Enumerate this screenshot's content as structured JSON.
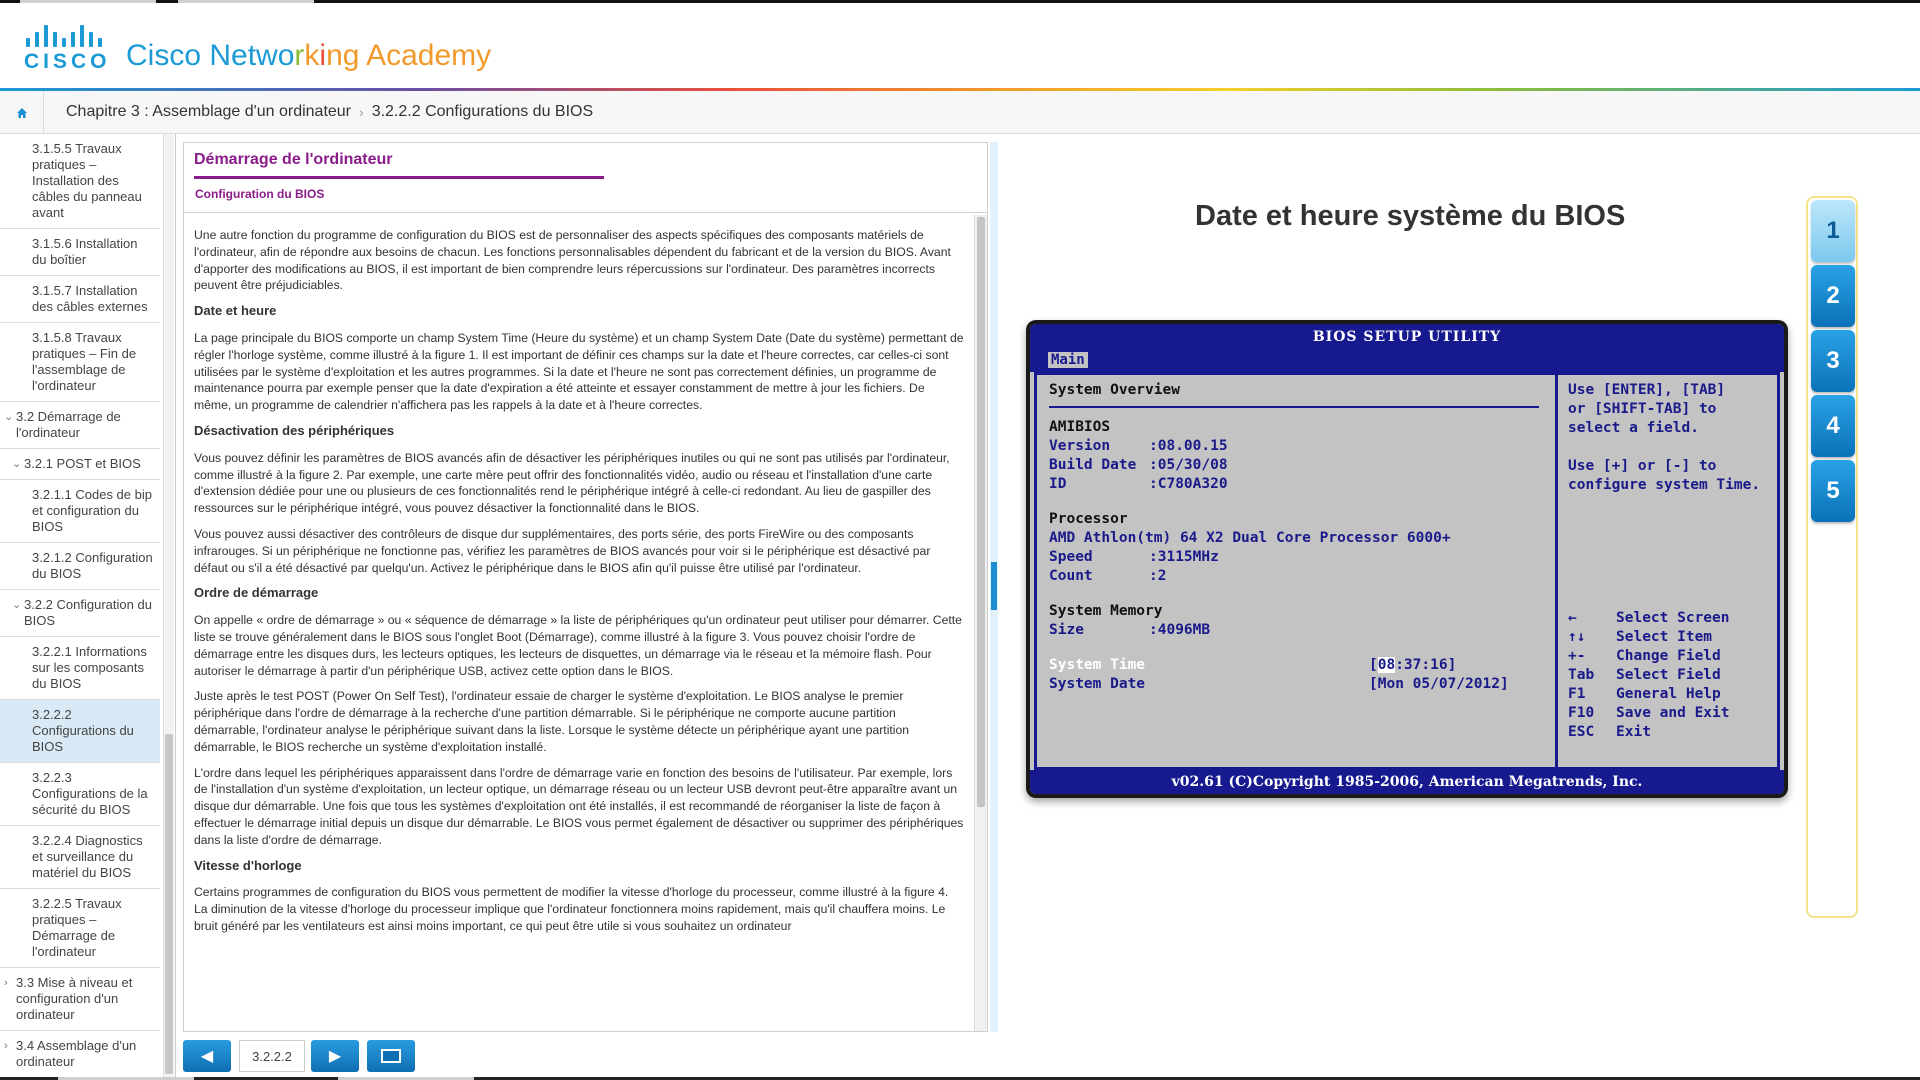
{
  "brand": {
    "logo_word": "CISCO",
    "name_parts": [
      "Cisco Netwo",
      "r",
      "k",
      "i",
      "ng Academy"
    ]
  },
  "breadcrumb": {
    "chapter": "Chapitre 3 : Assemblage d'un ordinateur",
    "section": "3.2.2.2 Configurations du BIOS"
  },
  "sidebar": {
    "items": [
      {
        "label": "3.1.5.5 Travaux pratiques – Installation des câbles du panneau avant",
        "level": 3
      },
      {
        "label": "3.1.5.6 Installation du boîtier",
        "level": 3
      },
      {
        "label": "3.1.5.7 Installation des câbles externes",
        "level": 3
      },
      {
        "label": "3.1.5.8 Travaux pratiques – Fin de l'assemblage de l'ordinateur",
        "level": 3
      },
      {
        "label": "3.2 Démarrage de l'ordinateur",
        "level": 1,
        "chevron": "⌄"
      },
      {
        "label": "3.2.1 POST et BIOS",
        "level": 2,
        "chevron": "⌄"
      },
      {
        "label": "3.2.1.1 Codes de bip et configuration du BIOS",
        "level": 3
      },
      {
        "label": "3.2.1.2 Configuration du BIOS",
        "level": 3
      },
      {
        "label": "3.2.2 Configuration du BIOS",
        "level": 2,
        "chevron": "⌄"
      },
      {
        "label": "3.2.2.1 Informations sur les composants du BIOS",
        "level": 3
      },
      {
        "label": "3.2.2.2 Configurations du BIOS",
        "level": 3,
        "active": true
      },
      {
        "label": "3.2.2.3 Configurations de la sécurité du BIOS",
        "level": 3
      },
      {
        "label": "3.2.2.4 Diagnostics et surveillance du matériel du BIOS",
        "level": 3
      },
      {
        "label": "3.2.2.5 Travaux pratiques – Démarrage de l'ordinateur",
        "level": 3
      },
      {
        "label": "3.3 Mise à niveau et configuration d'un ordinateur",
        "level": 1,
        "chevron": "›"
      },
      {
        "label": "3.4 Assemblage d'un ordinateur",
        "level": 1,
        "chevron": "›"
      }
    ]
  },
  "content": {
    "title": "Démarrage de l'ordinateur",
    "subtitle": "Configuration du BIOS",
    "blocks": [
      {
        "type": "p",
        "text": "Une autre fonction du programme de configuration du BIOS est de personnaliser des aspects spécifiques des composants matériels de l'ordinateur, afin de répondre aux besoins de chacun. Les fonctions personnalisables dépendent du fabricant et de la version du BIOS. Avant d'apporter des modifications au BIOS, il est important de bien comprendre leurs répercussions sur l'ordinateur. Des paramètres incorrects peuvent être préjudiciables."
      },
      {
        "type": "h",
        "text": "Date et heure"
      },
      {
        "type": "p",
        "text": "La page principale du BIOS comporte un champ System Time (Heure du système) et un champ System Date (Date du système) permettant de régler l'horloge système, comme illustré à la figure 1. Il est important de définir ces champs sur la date et l'heure correctes, car celles-ci sont utilisées par le système d'exploitation et les autres programmes. Si la date et l'heure ne sont pas correctement définies, un programme de maintenance pourra par exemple penser que la date d'expiration a été atteinte et essayer constamment de mettre à jour les fichiers. De même, un programme de calendrier n'affichera pas les rappels à la date et à l'heure correctes."
      },
      {
        "type": "h",
        "text": "Désactivation des périphériques"
      },
      {
        "type": "p",
        "text": "Vous pouvez définir les paramètres de BIOS avancés afin de désactiver les périphériques inutiles ou qui ne sont pas utilisés par l'ordinateur, comme illustré à la figure 2. Par exemple, une carte mère peut offrir des fonctionnalités vidéo, audio ou réseau et l'installation d'une carte d'extension dédiée pour une ou plusieurs de ces fonctionnalités rend le périphérique intégré à celle-ci redondant. Au lieu de gaspiller des ressources sur le périphérique intégré, vous pouvez désactiver la fonctionnalité dans le BIOS."
      },
      {
        "type": "p",
        "text": "Vous pouvez aussi désactiver des contrôleurs de disque dur supplémentaires, des ports série, des ports FireWire ou des composants infrarouges. Si un périphérique ne fonctionne pas, vérifiez les paramètres de BIOS avancés pour voir si le périphérique est désactivé par défaut ou s'il a été désactivé par quelqu'un. Activez le périphérique dans le BIOS afin qu'il puisse être utilisé par l'ordinateur."
      },
      {
        "type": "h",
        "text": "Ordre de démarrage"
      },
      {
        "type": "p",
        "text": "On appelle « ordre de démarrage » ou « séquence de démarrage » la liste de périphériques qu'un ordinateur peut utiliser pour démarrer. Cette liste se trouve généralement dans le BIOS sous l'onglet Boot (Démarrage), comme illustré à la figure 3. Vous pouvez choisir l'ordre de démarrage entre les disques durs, les lecteurs optiques, les lecteurs de disquettes, un démarrage via le réseau et la mémoire flash. Pour autoriser le démarrage à partir d'un périphérique USB, activez cette option dans le BIOS."
      },
      {
        "type": "p",
        "text": "Juste après le test POST (Power On Self Test), l'ordinateur essaie de charger le système d'exploitation. Le BIOS analyse le premier périphérique dans l'ordre de démarrage à la recherche d'une partition démarrable. Si le périphérique ne comporte aucune partition démarrable, l'ordinateur analyse le périphérique suivant dans la liste. Lorsque le système détecte un périphérique ayant une partition démarrable, le BIOS recherche un système d'exploitation installé."
      },
      {
        "type": "p",
        "text": "L'ordre dans lequel les périphériques apparaissent dans l'ordre de démarrage varie en fonction des besoins de l'utilisateur. Par exemple, lors de l'installation d'un système d'exploitation, un lecteur optique, un démarrage réseau ou un lecteur USB devront peut-être apparaître avant un disque dur démarrable. Une fois que tous les systèmes d'exploitation ont été installés, il est recommandé de réorganiser la liste de façon à effectuer le démarrage initial depuis un disque dur démarrable. Le BIOS vous permet également de désactiver ou supprimer des périphériques dans la liste d'ordre de démarrage."
      },
      {
        "type": "h",
        "text": "Vitesse d'horloge"
      },
      {
        "type": "p",
        "text": "Certains programmes de configuration du BIOS vous permettent de modifier la vitesse d'horloge du processeur, comme illustré à la figure 4. La diminution de la vitesse d'horloge du processeur implique que l'ordinateur fonctionnera moins rapidement, mais qu'il chauffera moins. Le bruit généré par les ventilateurs est ainsi moins important, ce qui peut être utile si vous souhaitez un ordinateur"
      }
    ]
  },
  "bottom_nav": {
    "page_label": "3.2.2.2",
    "prev_icon": "arrow-left-icon",
    "next_icon": "arrow-right-icon"
  },
  "figure": {
    "title": "Date et heure système du BIOS",
    "tabs": [
      "1",
      "2",
      "3",
      "4",
      "5"
    ],
    "active_tab": "1",
    "bios": {
      "title": "BIOS SETUP UTILITY",
      "tab": "Main",
      "overview": "System Overview",
      "amibios": "AMIBIOS",
      "version_label": "Version",
      "version_value": ":08.00.15",
      "build_label": "Build Date",
      "build_value": ":05/30/08",
      "id_label": "ID",
      "id_value": ":C780A320",
      "processor": "Processor",
      "cpu": "AMD Athlon(tm) 64 X2 Dual Core Processor 6000+",
      "speed_label": "Speed",
      "speed_value": ":3115MHz",
      "count_label": "Count",
      "count_value": ":2",
      "memory": "System Memory",
      "size_label": "Size",
      "size_value": ":4096MB",
      "time_label": "System Time",
      "time_value_hl": "08",
      "time_value_rest": ":37:16]",
      "date_label": "System Date",
      "date_value": "[Mon 05/07/2012]",
      "help_1": "Use [ENTER], [TAB]",
      "help_2": "or [SHIFT-TAB] to",
      "help_3": "select a field.",
      "help_4": "Use [+] or [-] to",
      "help_5": "configure system Time.",
      "keys": [
        {
          "k": "←",
          "v": "Select Screen"
        },
        {
          "k": "↑↓",
          "v": "Select Item"
        },
        {
          "k": "+-",
          "v": "Change Field"
        },
        {
          "k": "Tab",
          "v": "Select Field"
        },
        {
          "k": "F1",
          "v": "General Help"
        },
        {
          "k": "F10",
          "v": "Save and Exit"
        },
        {
          "k": "ESC",
          "v": "Exit"
        }
      ],
      "footer": "v02.61 (C)Copyright 1985-2006, American Megatrends, Inc."
    }
  },
  "colors": {
    "accent": "#1b9ad6",
    "heading": "#8a1c8a",
    "bios_blue": "#17198e",
    "bios_bg": "#c3c3c3"
  }
}
